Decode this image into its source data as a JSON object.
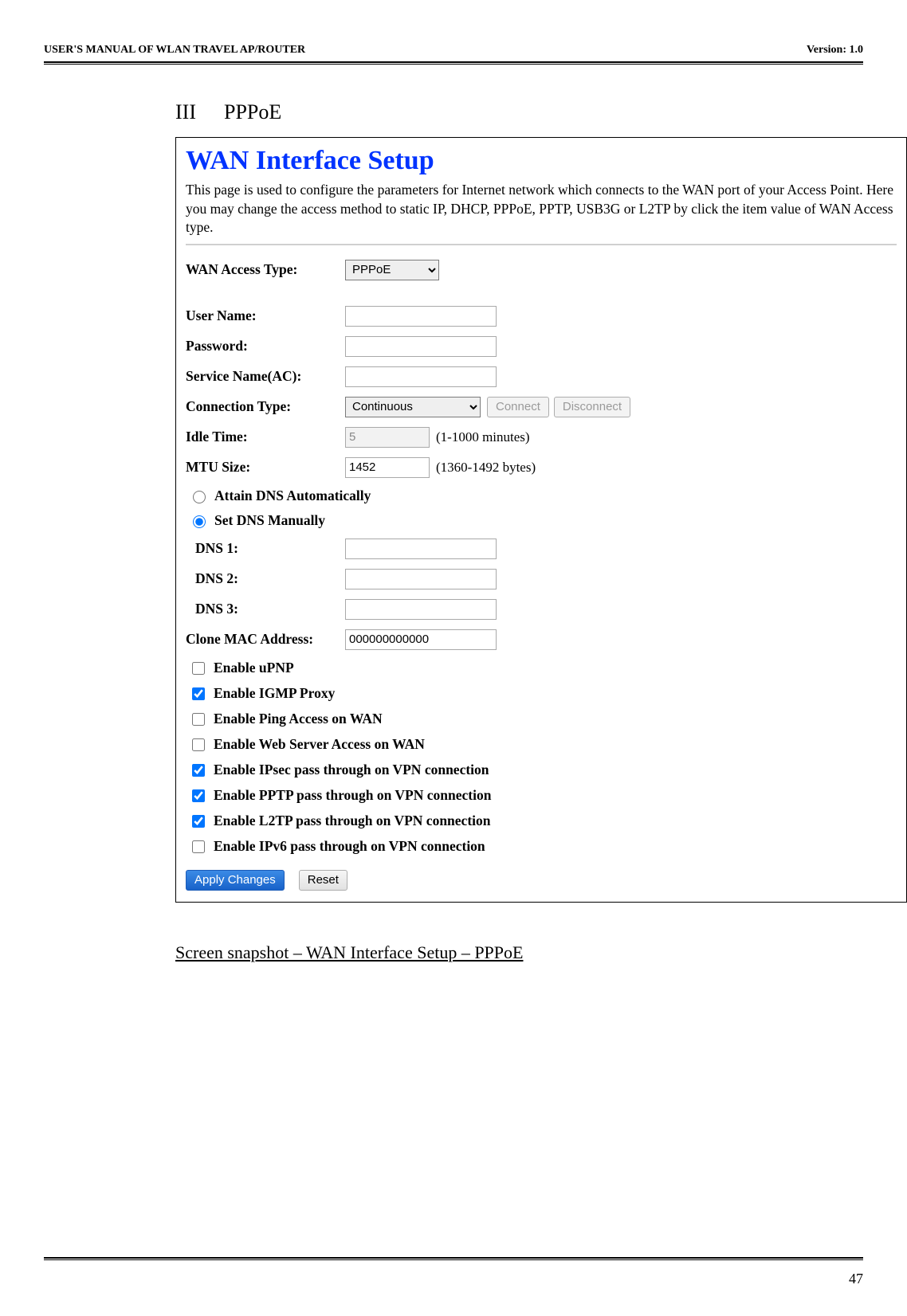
{
  "header": {
    "left": "USER'S MANUAL OF WLAN TRAVEL AP/ROUTER",
    "right": "Version: 1.0"
  },
  "section": {
    "numeral": "III",
    "title": "PPPoE"
  },
  "panel": {
    "title": "WAN Interface Setup",
    "desc": "This page is used to configure the parameters for Internet network which connects to the WAN port of your Access Point. Here you may change the access method to static IP, DHCP, PPPoE, PPTP, USB3G or L2TP by click the item value of WAN Access type."
  },
  "labels": {
    "wan_access": "WAN Access Type:",
    "user_name": "User Name:",
    "password": "Password:",
    "service_name": "Service Name(AC):",
    "conn_type": "Connection Type:",
    "idle_time": "Idle Time:",
    "mtu": "MTU Size:",
    "dns_auto": "Attain DNS Automatically",
    "dns_manual": "Set DNS Manually",
    "dns1": "DNS 1:",
    "dns2": "DNS 2:",
    "dns3": "DNS 3:",
    "clone_mac": "Clone MAC Address:",
    "upnp": "Enable uPNP",
    "igmp": "Enable IGMP Proxy",
    "ping": "Enable Ping Access on WAN",
    "web": "Enable Web Server Access on WAN",
    "ipsec": "Enable IPsec pass through on VPN connection",
    "pptp": "Enable PPTP pass through on VPN connection",
    "l2tp": "Enable L2TP pass through on VPN connection",
    "ipv6": "Enable IPv6 pass through on VPN connection"
  },
  "values": {
    "wan_access": "PPPoE",
    "user_name": "",
    "password": "",
    "service_name": "",
    "conn_type": "Continuous",
    "idle_time": "5",
    "idle_hint": "(1-1000 minutes)",
    "mtu": "1452",
    "mtu_hint": "(1360-1492 bytes)",
    "dns1": "",
    "dns2": "",
    "dns3": "",
    "clone_mac": "000000000000"
  },
  "buttons": {
    "connect": "Connect",
    "disconnect": "Disconnect",
    "apply": "Apply Changes",
    "reset": "Reset"
  },
  "caption": "Screen snapshot – WAN Interface Setup – PPPoE",
  "page_number": "47"
}
